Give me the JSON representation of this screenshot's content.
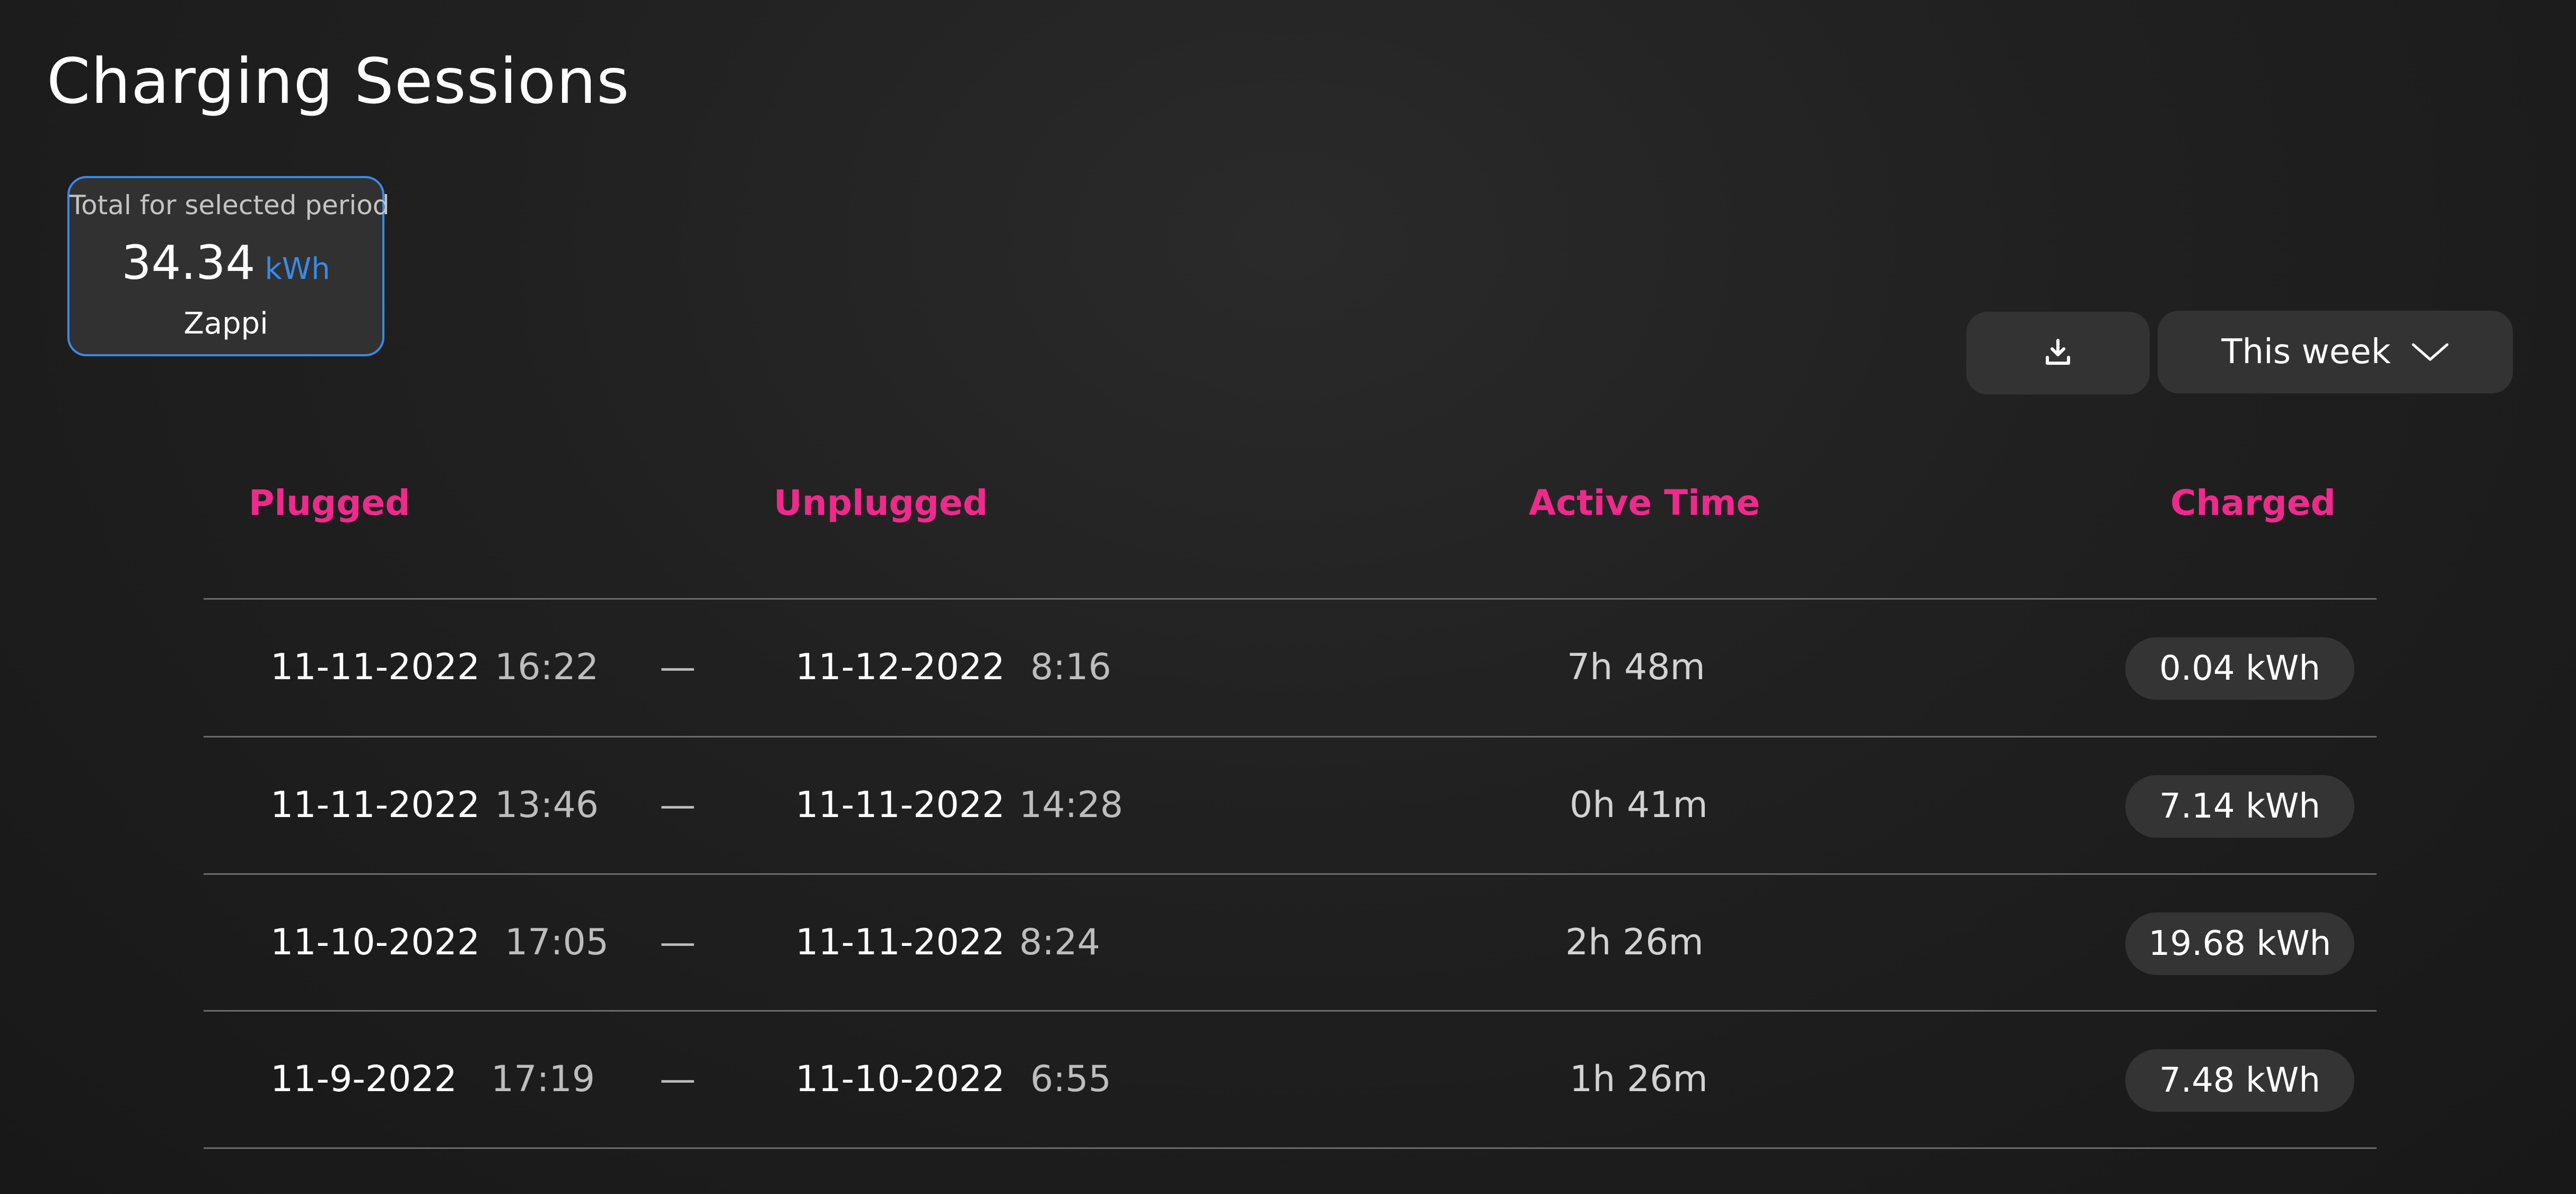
{
  "page": {
    "title": "Charging Sessions"
  },
  "total": {
    "caption": "Total for selected period",
    "value": "34.34",
    "unit": "kWh",
    "device": "Zappi"
  },
  "toolbar": {
    "download_icon": "download-icon",
    "period_label": "This week",
    "period_icon": "chevron-down-icon"
  },
  "table": {
    "headers": {
      "plugged": "Plugged",
      "unplugged": "Unplugged",
      "active_time": "Active Time",
      "charged": "Charged"
    },
    "separator": "—",
    "rows": [
      {
        "plugged_date": "11-11-2022",
        "plugged_time": "16:22",
        "unplugged_date": "11-12-2022",
        "unplugged_time": "8:16",
        "active_time": "7h 48m",
        "charged": "0.04 kWh"
      },
      {
        "plugged_date": "11-11-2022",
        "plugged_time": "13:46",
        "unplugged_date": "11-11-2022",
        "unplugged_time": "14:28",
        "active_time": "0h 41m",
        "charged": "7.14 kWh"
      },
      {
        "plugged_date": "11-10-2022",
        "plugged_time": "17:05",
        "unplugged_date": "11-11-2022",
        "unplugged_time": "8:24",
        "active_time": "2h 26m",
        "charged": "19.68 kWh"
      },
      {
        "plugged_date": "11-9-2022",
        "plugged_time": "17:19",
        "unplugged_date": "11-10-2022",
        "unplugged_time": "6:55",
        "active_time": "1h 26m",
        "charged": "7.48 kWh"
      }
    ]
  },
  "colors": {
    "accent_pink": "#ef2a8c",
    "accent_blue": "#3a8ae6",
    "background": "#1e1e1e"
  }
}
